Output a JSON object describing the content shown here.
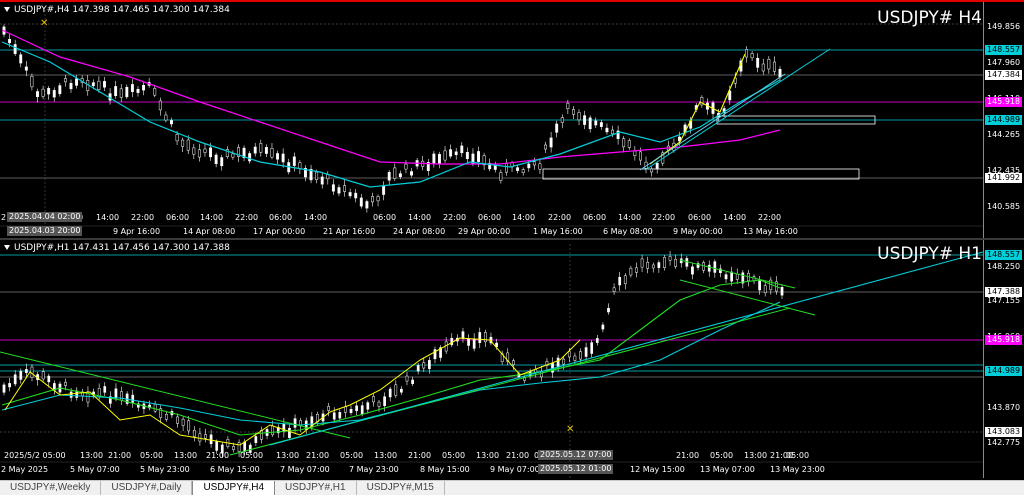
{
  "window": {
    "tabs": [
      {
        "label": "USDJPY#,Weekly",
        "active": false
      },
      {
        "label": "USDJPY#,Daily",
        "active": false
      },
      {
        "label": "USDJPY#,H4",
        "active": true
      },
      {
        "label": "USDJPY#,H1",
        "active": false
      },
      {
        "label": "USDJPY#,M15",
        "active": false
      }
    ]
  },
  "h4": {
    "header": "USDJPY#,H4  147.398 147.465 147.300 147.384",
    "big_symbol": "USDJPY#  H4",
    "price_ticks": [
      "149.856",
      "147.960",
      "146.110",
      "144.265",
      "142.435",
      "140.585"
    ],
    "price_tags": [
      {
        "label": "148.557",
        "color": "#00cfd9"
      },
      {
        "label": "147.384",
        "color": "#ffffff"
      },
      {
        "label": "145.918",
        "color": "#ff00ff"
      },
      {
        "label": "144.989",
        "color": "#00cfd9"
      },
      {
        "label": "141.992",
        "color": "#ffffff"
      }
    ],
    "time_ticks": [
      "06:00",
      "14:00",
      "22:00",
      "9 Apr 16:00",
      "06:00",
      "14:00",
      "14 Apr 08:00",
      "22:00",
      "17 Apr 00:00",
      "06:00",
      "14:00",
      "21 Apr 16:00",
      "06:00",
      "14:00",
      "24 Apr 08:00",
      "22:00",
      "29 Apr 00:00",
      "06:00",
      "14:00",
      "22:00",
      "1 May 16:00",
      "06:00",
      "6 May 08:00",
      "14:00",
      "22:00",
      "9 May 00:00",
      "06:00",
      "14:00",
      "22:00",
      "13 May 16:00"
    ],
    "crosshair_label": "2025.04.04 02:00",
    "crosshair_label2": "2025.04.03 20:00",
    "first_label": "2"
  },
  "h1": {
    "header": "USDJPY#,H1  147.431 147.456 147.300 147.388",
    "big_symbol": "USDJPY#  H1",
    "price_ticks": [
      "148.250",
      "147.155",
      "146.060",
      "144.965",
      "143.870",
      "142.775"
    ],
    "price_tags": [
      {
        "label": "148.557",
        "color": "#00cfd9"
      },
      {
        "label": "147.388",
        "color": "#ffffff"
      },
      {
        "label": "145.918",
        "color": "#ff00ff"
      },
      {
        "label": "144.989",
        "color": "#00cfd9"
      },
      {
        "label": "143.083",
        "color": "#ffffff"
      }
    ],
    "time_ticks": [
      "2 May 2025",
      "5 May 07:00",
      "5 May 23:00",
      "6 May 15:00",
      "7 May 07:00",
      "7 May 23:00",
      "8 May 15:00",
      "9 May 07:00",
      "12 May 15:00",
      "13 May 07:00",
      "13 May 23:00"
    ],
    "mid_ticks": [
      "2025/5/2 05:00",
      "13:00",
      "21:00",
      "05:00",
      "13:00",
      "21:00",
      "05:00",
      "13:00",
      "21:00",
      "05:00",
      "13:00",
      "21:00",
      "05:00",
      "13:00",
      "21:00",
      "05:00",
      "13:00",
      "21:00",
      "05:00",
      "21:00",
      "05:00",
      "13:00",
      "21:00",
      "05:00"
    ],
    "crosshair_label": "2025.05.12 07:00",
    "crosshair_label2": "2025.05.12 01:00"
  }
}
